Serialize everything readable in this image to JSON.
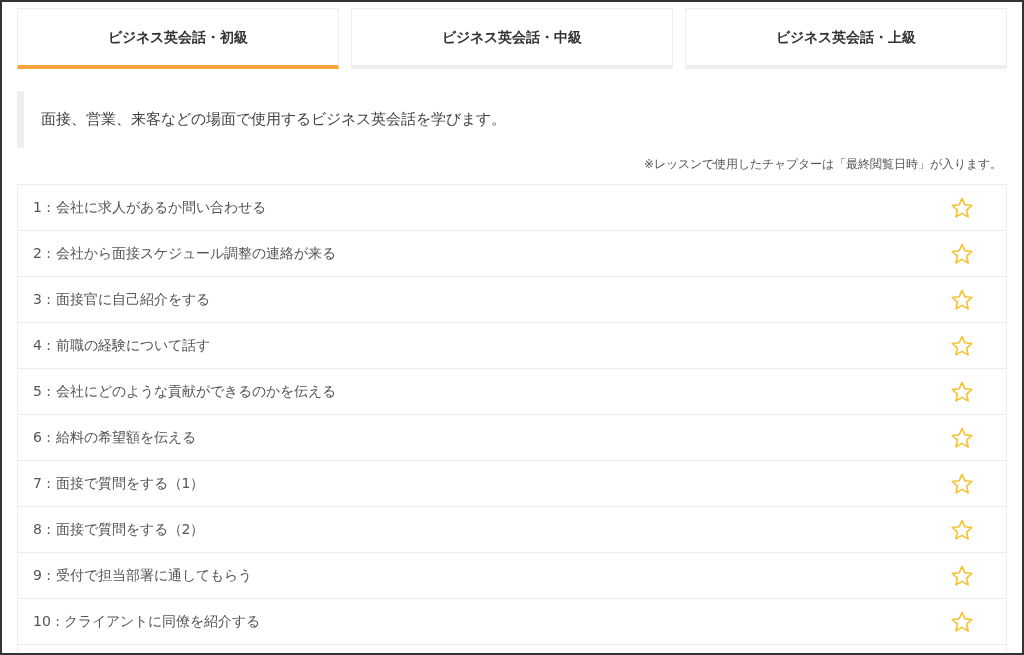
{
  "tabs": [
    {
      "label": "ビジネス英会話・初級",
      "selected": true
    },
    {
      "label": "ビジネス英会話・中級",
      "selected": false
    },
    {
      "label": "ビジネス英会話・上級",
      "selected": false
    }
  ],
  "description": "面接、営業、来客などの場面で使用するビジネス英会話を学びます。",
  "note": "※レッスンで使用したチャプターは「最終閲覧日時」が入ります。",
  "chapters": [
    {
      "title": "1 : 会社に求人があるか問い合わせる",
      "starred": false
    },
    {
      "title": "2 : 会社から面接スケジュール調整の連絡が来る",
      "starred": false
    },
    {
      "title": "3 : 面接官に自己紹介をする",
      "starred": false
    },
    {
      "title": "4 : 前職の経験について話す",
      "starred": false
    },
    {
      "title": "5 : 会社にどのような貢献ができるのかを伝える",
      "starred": false
    },
    {
      "title": "6 : 給料の希望額を伝える",
      "starred": false
    },
    {
      "title": "7 : 面接で質問をする（1）",
      "starred": false
    },
    {
      "title": "8 : 面接で質問をする（2）",
      "starred": false
    },
    {
      "title": "9 : 受付で担当部署に通してもらう",
      "starred": false
    },
    {
      "title": "10 : クライアントに同僚を紹介する",
      "starred": false
    }
  ]
}
